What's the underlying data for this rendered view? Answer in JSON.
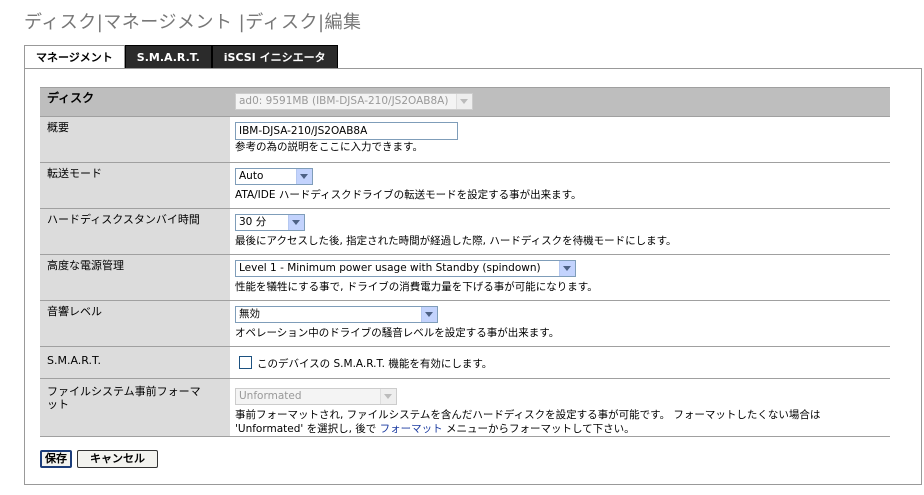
{
  "page": {
    "title": "ディスク|マネージメント |ディスク|編集"
  },
  "tabs": [
    {
      "label": "マネージメント",
      "active": true
    },
    {
      "label": "S.M.A.R.T.",
      "active": false
    },
    {
      "label": "iSCSI イニシエータ",
      "active": false
    }
  ],
  "form": {
    "disk": {
      "label": "ディスク",
      "value": "ad0: 9591MB (IBM-DJSA-210/JS2OAB8A)"
    },
    "description": {
      "label": "概要",
      "value": "IBM-DJSA-210/JS2OAB8A",
      "help": "参考の為の説明をここに入力できます。"
    },
    "transfer_mode": {
      "label": "転送モード",
      "value": "Auto",
      "help": "ATA/IDE ハードディスクドライブの転送モードを設定する事が出来ます。"
    },
    "standby": {
      "label": "ハードディスクスタンバイ時間",
      "value": "30 分",
      "help": "最後にアクセスした後, 指定された時間が経過した際, ハードディスクを待機モードにします。"
    },
    "power": {
      "label": "高度な電源管理",
      "value": "Level 1 - Minimum power usage with Standby (spindown)",
      "help": "性能を犠牲にする事で, ドライブの消費電力量を下げる事が可能になります。"
    },
    "acoustic": {
      "label": "音響レベル",
      "value": "無効",
      "help": "オペレーション中のドライブの騒音レベルを設定する事が出来ます。"
    },
    "smart": {
      "label": "S.M.A.R.T.",
      "checkbox_label": "このデバイスの S.M.A.R.T. 機能を有効にします。",
      "checked": false
    },
    "preformat": {
      "label": "ファイルシステム事前フォーマット",
      "value": "Unformated",
      "help_line1": "事前フォーマットされ, ファイルシステムを含んだハードディスクを設定する事が可能です。 フォーマットしたくない場合は",
      "help_line2_before": "'Unformated' を選択し, 後で",
      "help_link": "フォーマット",
      "help_line2_after": "メニューからフォーマットして下さい。"
    }
  },
  "buttons": {
    "save": "保存",
    "cancel": "キャンセル"
  },
  "colors": {
    "tab_inactive_bg": "#2b2b2b",
    "label_bg": "#dcdcdc",
    "header_bg": "#bebebe",
    "link": "#1a3aa0"
  }
}
